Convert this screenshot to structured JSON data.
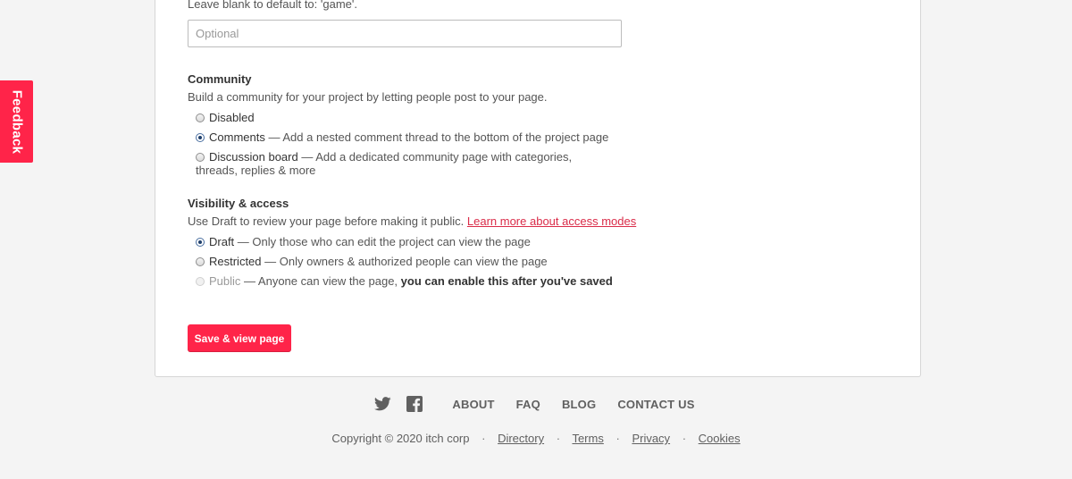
{
  "feedback": {
    "label": "Feedback"
  },
  "classification": {
    "hint": "Leave blank to default to: 'game'.",
    "placeholder": "Optional",
    "value": ""
  },
  "community": {
    "title": "Community",
    "description": "Build a community for your project by letting people post to your page.",
    "options": [
      {
        "label": "Disabled",
        "detail": "",
        "checked": false
      },
      {
        "label": "Comments",
        "detail": " — Add a nested comment thread to the bottom of the project page",
        "checked": true
      },
      {
        "label": "Discussion board",
        "detail": " — Add a dedicated community page with categories, threads, replies & more",
        "checked": false
      }
    ]
  },
  "visibility": {
    "title": "Visibility & access",
    "description": "Use Draft to review your page before making it public.",
    "link": "Learn more about access modes",
    "options": [
      {
        "label": "Draft",
        "detail": " — Only those who can edit the project can view the page",
        "checked": true
      },
      {
        "label": "Restricted",
        "detail": " — Only owners & authorized people can view the page",
        "checked": false
      },
      {
        "label": "Public",
        "detail": " — Anyone can view the page, ",
        "emphasis": "you can enable this after you've saved",
        "checked": false,
        "disabled": true
      }
    ]
  },
  "save_button": "Save & view page",
  "footer": {
    "icons": [
      "twitter-icon",
      "facebook-icon"
    ],
    "links": [
      "ABOUT",
      "FAQ",
      "BLOG",
      "CONTACT US"
    ],
    "copyright": "Copyright © 2020 itch corp",
    "legal": [
      "Directory",
      "Terms",
      "Privacy",
      "Cookies"
    ],
    "separator": "·"
  },
  "colors": {
    "accent": "#ff2449",
    "link": "#da2c49",
    "background": "#f4f4f4",
    "panel": "#ffffff"
  }
}
